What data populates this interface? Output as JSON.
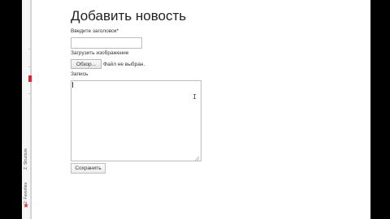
{
  "form": {
    "title": "Добавить новость",
    "title_label": "Введите заголовок*",
    "title_value": "",
    "image_label": "Загрузить изображение",
    "browse_label": "Обзор...",
    "file_status": "Файл не выбран.",
    "post_label": "Запись",
    "post_value": "",
    "save_label": "Сохранить"
  },
  "sidebar": {
    "tabs": [
      {
        "label": "Z: Structure",
        "icon": "structure-icon"
      },
      {
        "label": "2: Favorites",
        "icon": "star-icon"
      }
    ]
  },
  "colors": {
    "sidebar_accent": "#dd2233"
  }
}
